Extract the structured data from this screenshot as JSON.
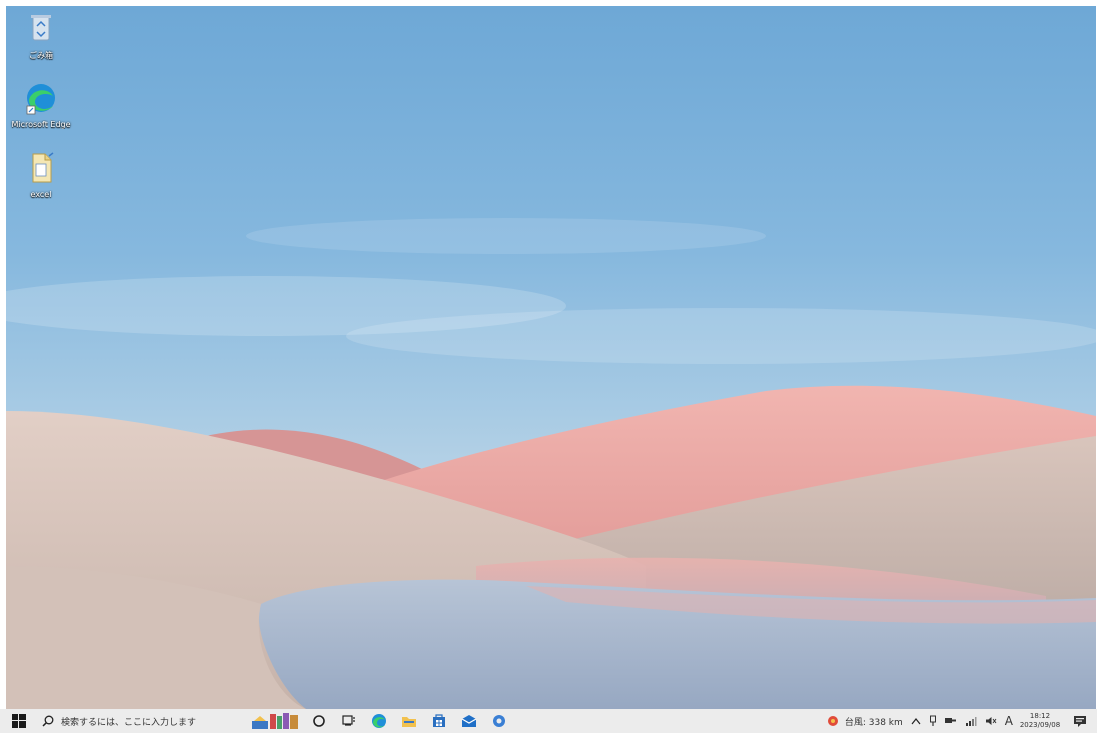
{
  "desktop": {
    "icons": [
      {
        "name": "recycle-bin-icon",
        "label": "ごみ箱"
      },
      {
        "name": "edge-icon",
        "label": "Microsoft Edge"
      },
      {
        "name": "file-icon",
        "label": "excel"
      }
    ]
  },
  "taskbar": {
    "start_icon": "windows-logo-icon",
    "search_placeholder": "検索するには、ここに入力します",
    "pinned_apps": [
      "people-widget",
      "cortana",
      "task-view",
      "edge",
      "file-explorer",
      "store",
      "mail",
      "settings"
    ],
    "weather_text": "台風: 338 km",
    "input_indicator": "A",
    "clock_time": "18:12",
    "clock_date": "2023/09/08"
  },
  "colors": {
    "sky_top": "#6ea8d6",
    "taskbar_bg": "#ececec",
    "hills_pink": "#e9a6a4",
    "sand": "#d7c7bd"
  }
}
